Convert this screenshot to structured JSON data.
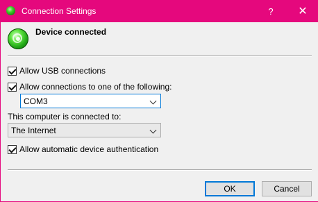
{
  "window": {
    "title": "Connection Settings"
  },
  "titlebar": {
    "help_label": "?",
    "close_label": "✕"
  },
  "status": {
    "heading": "Device connected",
    "icon": "device-connected-icon"
  },
  "options": {
    "allow_usb": {
      "label": "Allow USB connections",
      "checked": true
    },
    "allow_one_of": {
      "label": "Allow connections to one of the following:",
      "checked": true
    },
    "port_select": {
      "value": "COM3"
    },
    "connected_to_label": "This computer is connected to:",
    "network_select": {
      "value": "The Internet"
    },
    "auto_auth": {
      "label": "Allow automatic device authentication",
      "checked": true
    }
  },
  "buttons": {
    "ok": "OK",
    "cancel": "Cancel"
  },
  "colors": {
    "titlebar": "#e5087d",
    "focus_accent": "#0078d7",
    "background": "#f0f0f0"
  }
}
